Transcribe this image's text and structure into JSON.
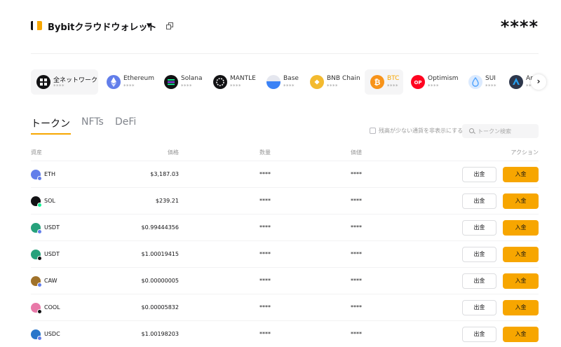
{
  "header": {
    "wallet_title": "Bybitクラウドウォレット",
    "caret": "▼",
    "balance": "****"
  },
  "chains": [
    {
      "name": "全ネットワーク",
      "value": "****",
      "color": "#121214",
      "icon": "all-networks-icon"
    },
    {
      "name": "Ethereum",
      "value": "****",
      "color": "#627eea",
      "icon": "ethereum-icon"
    },
    {
      "name": "Solana",
      "value": "****",
      "color": "#121214",
      "icon": "solana-icon"
    },
    {
      "name": "MANTLE",
      "value": "****",
      "color": "#121214",
      "icon": "mantle-icon"
    },
    {
      "name": "Base",
      "value": "****",
      "color": "#3b82f6",
      "icon": "base-icon"
    },
    {
      "name": "BNB Chain",
      "value": "****",
      "color": "#f3ba2f",
      "icon": "bnb-chain-icon"
    },
    {
      "name": "BTC",
      "value": "****",
      "color": "#f7931a",
      "icon": "btc-icon"
    },
    {
      "name": "Optimism",
      "value": "****",
      "color": "#ff0420",
      "icon": "optimism-icon",
      "icon_text": "OP"
    },
    {
      "name": "SUI",
      "value": "****",
      "color": "#dbeafe",
      "icon": "sui-icon"
    },
    {
      "name": "Ar",
      "value": "****",
      "color": "#2d374b",
      "icon": "arbitrum-icon"
    }
  ],
  "scroll_arrow": "›",
  "tabs": [
    {
      "label": "トークン",
      "active": true
    },
    {
      "label": "NFTs",
      "active": false
    },
    {
      "label": "DeFi",
      "active": false
    }
  ],
  "hide_small_label": "残高が少ない通貨を非表示にする",
  "search": {
    "placeholder": "トークン検索"
  },
  "table": {
    "headers": {
      "asset": "資産",
      "price": "価格",
      "quantity": "数量",
      "value": "価値",
      "action": "アクション"
    },
    "withdraw_label": "出金",
    "deposit_label": "入金",
    "rows": [
      {
        "symbol": "ETH",
        "price": "$3,187.03",
        "quantity": "****",
        "value": "****",
        "color": "#627eea",
        "badge": "#627eea"
      },
      {
        "symbol": "SOL",
        "price": "$239.21",
        "quantity": "****",
        "value": "****",
        "color": "#121214",
        "badge": "#14f195"
      },
      {
        "symbol": "USDT",
        "price": "$0.99444356",
        "quantity": "****",
        "value": "****",
        "color": "#26a17b",
        "badge": "#627eea"
      },
      {
        "symbol": "USDT",
        "price": "$1.00019415",
        "quantity": "****",
        "value": "****",
        "color": "#26a17b",
        "badge": "#121214"
      },
      {
        "symbol": "CAW",
        "price": "$0.00000005",
        "quantity": "****",
        "value": "****",
        "color": "#a0722a",
        "badge": "#627eea"
      },
      {
        "symbol": "COOL",
        "price": "$0.00005832",
        "quantity": "****",
        "value": "****",
        "color": "#e879a8",
        "badge": "#121214"
      },
      {
        "symbol": "USDC",
        "price": "$1.00198203",
        "quantity": "****",
        "value": "****",
        "color": "#2775ca",
        "badge": "#627eea"
      }
    ]
  },
  "colors": {
    "accent": "#f7a600",
    "muted": "#81858c"
  }
}
